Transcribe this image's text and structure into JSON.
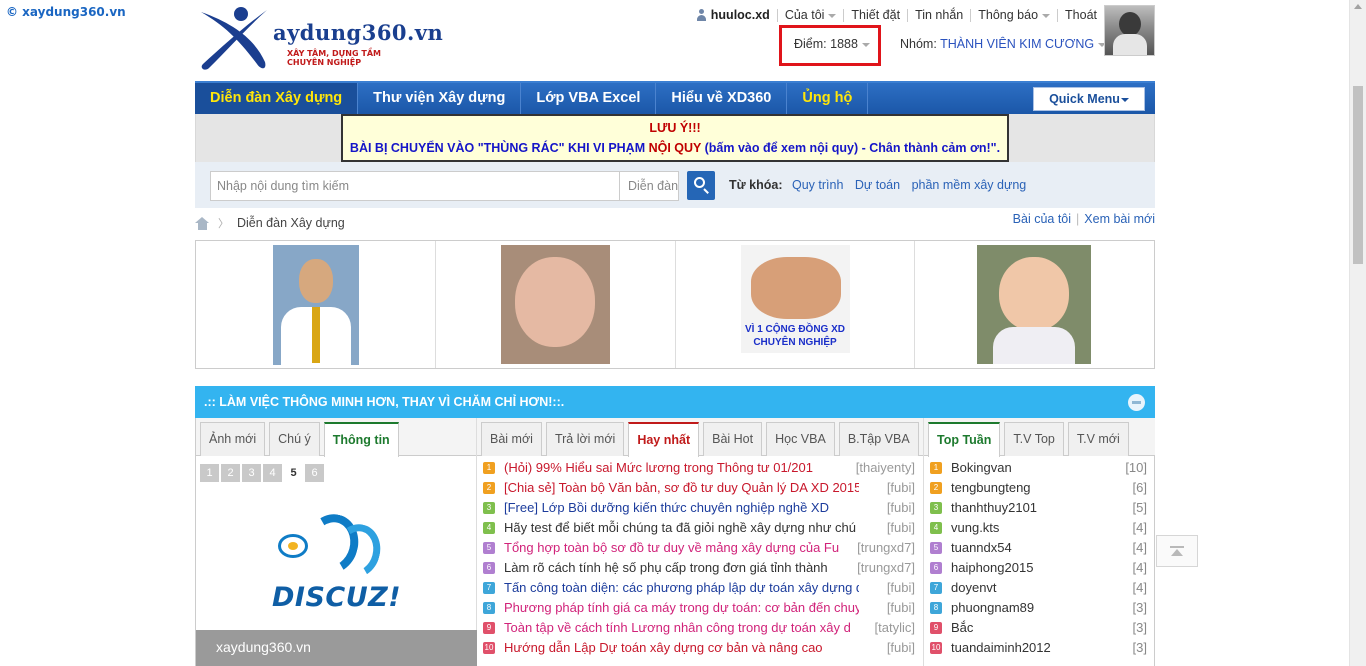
{
  "corner_link": "© xaydung360.vn",
  "logo": {
    "text": "aydung360.vn",
    "tagline": "XÂY TÂM, DỰNG TẦM CHUYÊN NGHIỆP"
  },
  "topnav": {
    "username": "huuloc.xd",
    "items": [
      {
        "label": "Của tôi",
        "caret": true
      },
      {
        "label": "Thiết đặt",
        "caret": false
      },
      {
        "label": "Tin nhắn",
        "caret": false
      },
      {
        "label": "Thông báo",
        "caret": true
      },
      {
        "label": "Thoát",
        "caret": false
      }
    ],
    "points_label": "Điểm: 1888",
    "group_label": "Nhóm:",
    "group_value": "THÀNH VIÊN KIM CƯƠNG"
  },
  "navbar": {
    "items": [
      "Diễn đàn Xây dựng",
      "Thư viện Xây dựng",
      "Lớp VBA Excel",
      "Hiểu về XD360",
      "Ủng hộ"
    ],
    "quick_menu": "Quick Menu"
  },
  "notice": {
    "line1": "LƯU Ý!!!",
    "line2_a": "BÀI BỊ CHUYỂN VÀO \"THÙNG RÁC\" KHI VI PHẠM ",
    "line2_b": "NỘI QUY",
    "line2_c": " (bấm vào để xem nội quy) - ",
    "line2_d": "Chân thành cảm ơn!",
    "line2_e": "\"."
  },
  "search": {
    "placeholder": "Nhập nội dung tìm kiếm",
    "scope": "Diễn đàn",
    "keywords_label": "Từ khóa:",
    "keywords": [
      "Quy trình",
      "Dự toán",
      "phần mềm xây dựng"
    ]
  },
  "breadcrumb": {
    "current": "Diễn đàn Xây dựng"
  },
  "right_links": [
    "Bài của tôi",
    "Xem bài mới"
  ],
  "photos": {
    "caption3": "VÌ 1 CỘNG ĐỒNG XD CHUYÊN NGHIỆP"
  },
  "block": {
    "title": ".:: LÀM VIỆC THÔNG MINH HƠN, THAY VÌ CHĂM CHỈ HƠN!::.",
    "col1_tabs": [
      "Ảnh mới",
      "Chú ý",
      "Thông tin"
    ],
    "col1_active": 2,
    "pager": [
      "1",
      "2",
      "3",
      "4",
      "5",
      "6"
    ],
    "pager_current": "5",
    "discuz_text": "DISCUZ!",
    "site_label": "xaydung360.vn",
    "col2_tabs": [
      "Bài mới",
      "Trả lời mới",
      "Hay nhất",
      "Bài Hot",
      "Học VBA",
      "B.Tập VBA"
    ],
    "col2_active": 2,
    "col3_tabs": [
      "Top Tuần",
      "T.V Top",
      "T.V mới"
    ],
    "col3_active": 0,
    "threads": [
      {
        "num": "1",
        "icon_color": "#f0a020",
        "title": "(Hỏi) 99% Hiểu sai Mức lương trong Thông tư 01/201",
        "title_color": "#c8182c",
        "by": "[thaiyenty]"
      },
      {
        "num": "2",
        "icon_color": "#f0a020",
        "title": "[Chia sẻ] Toàn bộ Văn bản, sơ đồ tư duy Quản lý DA XD 2015",
        "title_color": "#c8182c",
        "by": "[fubi]"
      },
      {
        "num": "3",
        "icon_color": "#7fbf4d",
        "title": "[Free] Lớp Bồi dưỡng kiến thức chuyên nghiệp nghề XD",
        "title_color": "#1c3c9c",
        "by": "[fubi]"
      },
      {
        "num": "4",
        "icon_color": "#7fbf4d",
        "title": "Hãy test để biết mỗi chúng ta đã giỏi nghề xây dựng như chú",
        "title_color": "#333333",
        "by": "[fubi]"
      },
      {
        "num": "5",
        "icon_color": "#b07fd0",
        "title": "Tổng hợp toàn bộ sơ đồ tư duy về mảng xây dựng của Fu",
        "title_color": "#d1237a",
        "by": "[trungxd7]"
      },
      {
        "num": "6",
        "icon_color": "#b07fd0",
        "title": "Làm rõ cách tính hệ số phụ cấp trong đơn giá tỉnh thành",
        "title_color": "#333333",
        "by": "[trungxd7]"
      },
      {
        "num": "7",
        "icon_color": "#3ea6d9",
        "title": "Tấn công toàn diện: các phương pháp lập dự toán xây dựng q",
        "title_color": "#1c3c9c",
        "by": "[fubi]"
      },
      {
        "num": "8",
        "icon_color": "#3ea6d9",
        "title": "Phương pháp tính giá ca máy trong dự toán: cơ bản đến chuy",
        "title_color": "#d1237a",
        "by": "[fubi]"
      },
      {
        "num": "9",
        "icon_color": "#e0506a",
        "title": "Toàn tập về cách tính Lương nhân công trong dự toán xây d",
        "title_color": "#d1237a",
        "by": "[tatylic]"
      },
      {
        "num": "10",
        "icon_color": "#e0506a",
        "title": "Hướng dẫn Lập Dự toán xây dựng cơ bản và nâng cao",
        "title_color": "#c8182c",
        "by": "[fubi]"
      }
    ],
    "top_users": [
      {
        "num": "1",
        "icon_color": "#f0a020",
        "name": "Bokingvan",
        "count": "[10]"
      },
      {
        "num": "2",
        "icon_color": "#f0a020",
        "name": "tengbungteng",
        "count": "[6]"
      },
      {
        "num": "3",
        "icon_color": "#7fbf4d",
        "name": "thanhthuy2101",
        "count": "[5]"
      },
      {
        "num": "4",
        "icon_color": "#7fbf4d",
        "name": "vung.kts",
        "count": "[4]"
      },
      {
        "num": "5",
        "icon_color": "#b07fd0",
        "name": "tuanndx54",
        "count": "[4]"
      },
      {
        "num": "6",
        "icon_color": "#b07fd0",
        "name": "haiphong2015",
        "count": "[4]"
      },
      {
        "num": "7",
        "icon_color": "#3ea6d9",
        "name": "doyenvt",
        "count": "[4]"
      },
      {
        "num": "8",
        "icon_color": "#3ea6d9",
        "name": "phuongnam89",
        "count": "[3]"
      },
      {
        "num": "9",
        "icon_color": "#e0506a",
        "name": "Bắc",
        "count": "[3]"
      },
      {
        "num": "10",
        "icon_color": "#e0506a",
        "name": "tuandaiminh2012",
        "count": "[3]"
      }
    ]
  }
}
